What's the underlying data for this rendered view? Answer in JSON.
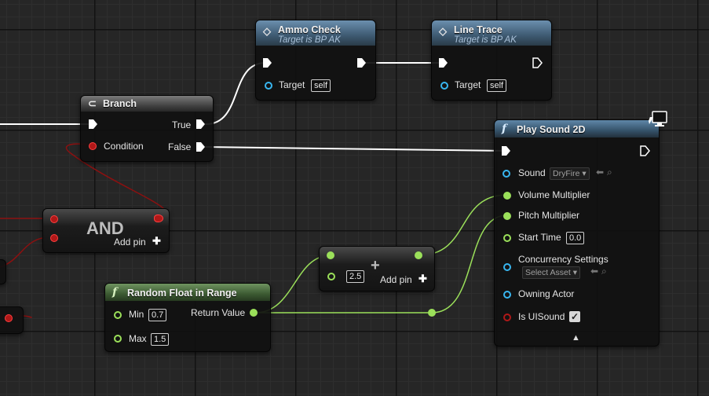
{
  "colors": {
    "exec": "#ffffff",
    "bool": "#b01818",
    "float": "#9be05a",
    "object": "#38b6f0",
    "grid": "#262626"
  },
  "nodes": {
    "ammo_check": {
      "title": "Ammo Check",
      "subtitle": "Target is BP AK",
      "target_label": "Target",
      "target_value": "self"
    },
    "line_trace": {
      "title": "Line Trace",
      "subtitle": "Target is BP AK",
      "target_label": "Target",
      "target_value": "self"
    },
    "branch": {
      "title": "Branch",
      "condition": "Condition",
      "true_label": "True",
      "false_label": "False",
      "icon": "branch-icon"
    },
    "and": {
      "title": "AND",
      "add_pin": "Add pin"
    },
    "add": {
      "value": "2.5",
      "add_pin": "Add pin",
      "operator": "+"
    },
    "random_float": {
      "title": "Random Float in Range",
      "min_label": "Min",
      "min_value": "0.7",
      "max_label": "Max",
      "max_value": "1.5",
      "return_label": "Return Value",
      "icon": "function-icon"
    },
    "play_sound": {
      "title": "Play Sound 2D",
      "sound_label": "Sound",
      "sound_value": "DryFire",
      "volume": "Volume Multiplier",
      "pitch": "Pitch Multiplier",
      "start_time": "Start Time",
      "start_time_value": "0.0",
      "concurrency": "Concurrency Settings",
      "concurrency_value": "Select Asset",
      "owning_actor": "Owning Actor",
      "is_ui_sound": "Is UISound",
      "is_ui_sound_checked": true,
      "icon": "function-icon"
    }
  }
}
